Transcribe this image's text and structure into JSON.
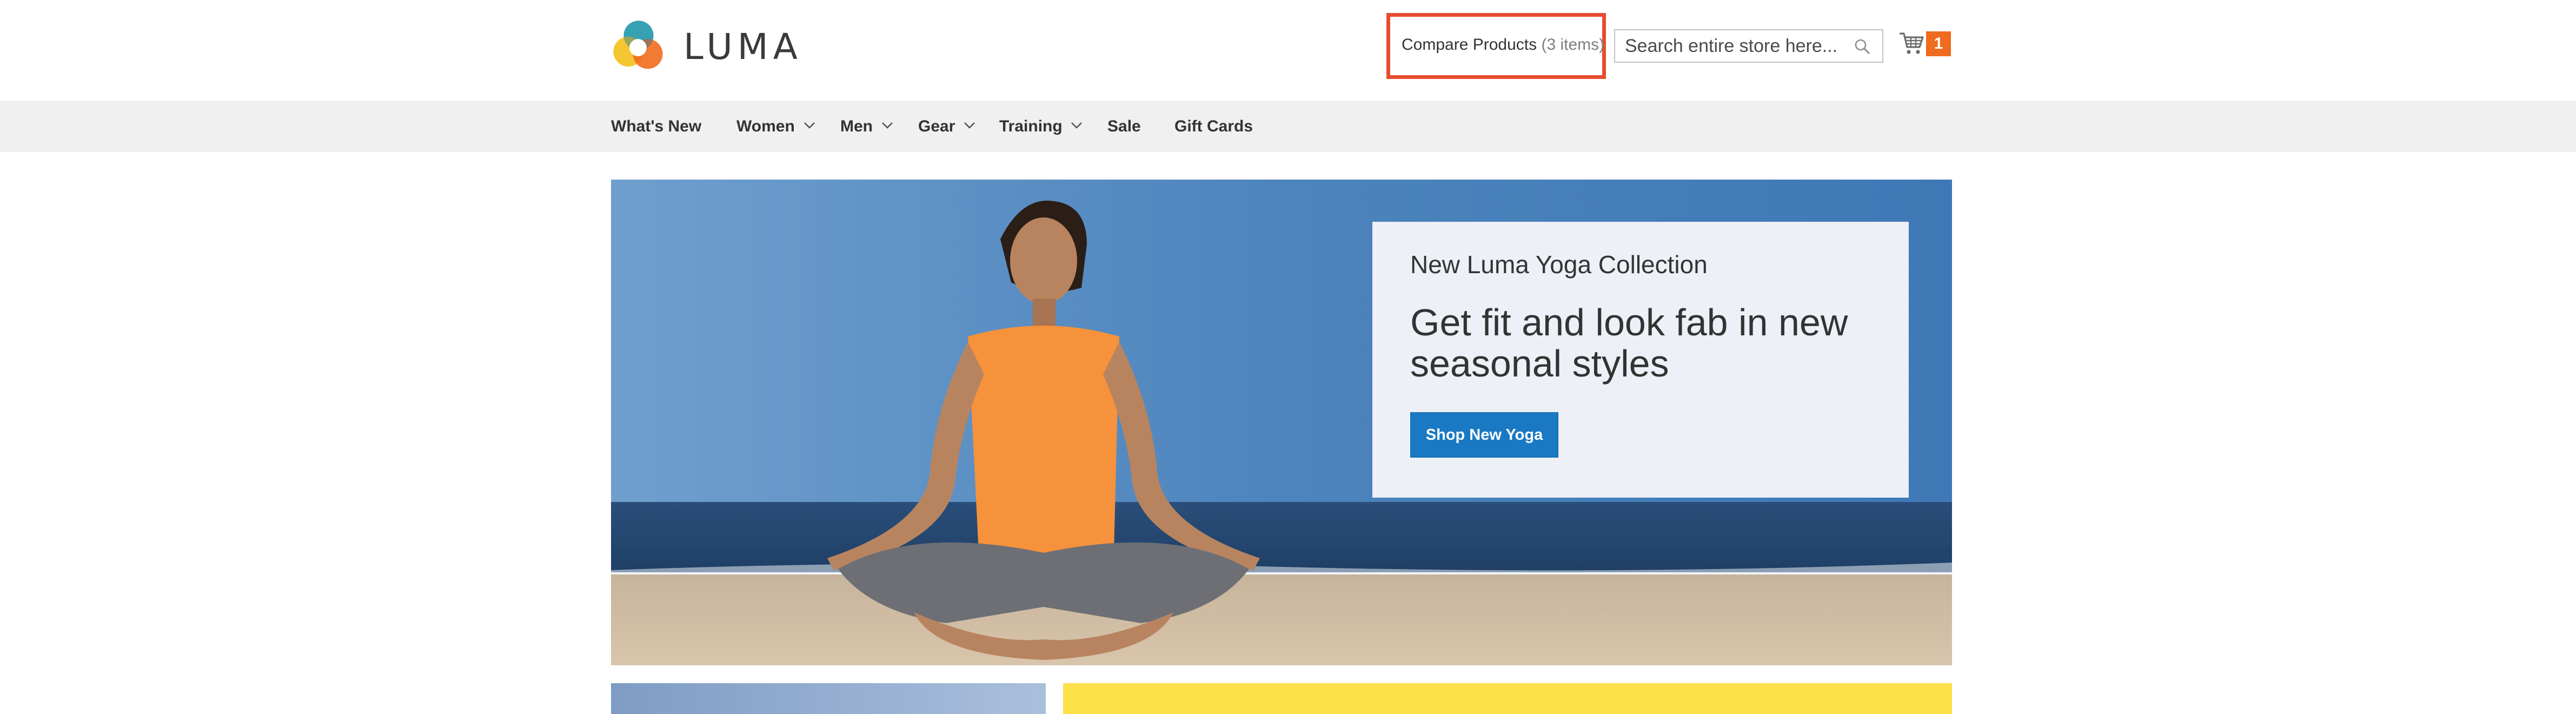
{
  "header": {
    "logo_text": "LUMA",
    "compare": {
      "label": "Compare Products",
      "count": "(3 items)"
    },
    "search": {
      "placeholder": "Search entire store here..."
    },
    "cart": {
      "count": "1"
    }
  },
  "nav": {
    "items": [
      {
        "label": "What's New",
        "has_dropdown": false
      },
      {
        "label": "Women",
        "has_dropdown": true
      },
      {
        "label": "Men",
        "has_dropdown": true
      },
      {
        "label": "Gear",
        "has_dropdown": true
      },
      {
        "label": "Training",
        "has_dropdown": true
      },
      {
        "label": "Sale",
        "has_dropdown": false
      },
      {
        "label": "Gift Cards",
        "has_dropdown": false
      }
    ]
  },
  "hero": {
    "kicker": "New Luma Yoga Collection",
    "headline": "Get fit and look fab in new seasonal styles",
    "button_label": "Shop New Yoga"
  },
  "icons": {
    "search": "search-icon",
    "cart": "cart-icon",
    "dropdown": "chevron-down-icon"
  },
  "colors": {
    "accent_orange": "#ef6b1e",
    "highlight_border": "#e54d2e",
    "primary_button": "#1979c3",
    "nav_background": "#f0f0f0",
    "promo_panel": "#edf0f6",
    "yellow_block": "#fde04a"
  }
}
